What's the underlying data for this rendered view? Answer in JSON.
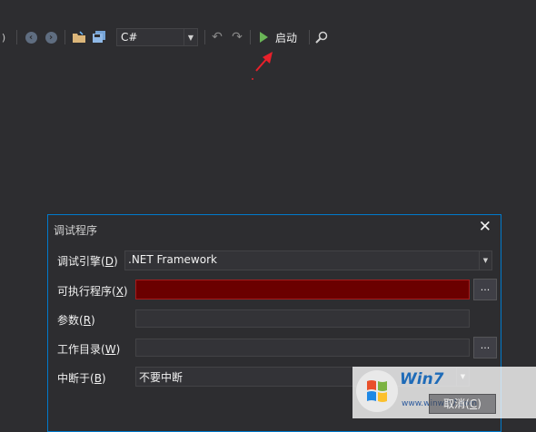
{
  "toolbar": {
    "language": "C#",
    "start_label": "启动"
  },
  "dialog": {
    "title": "调试程序",
    "close_icon": "close-icon",
    "fields": {
      "engine": {
        "label": "调试引擎(",
        "key": "D",
        "value": ".NET Framework"
      },
      "executable": {
        "label": "可执行程序(",
        "key": "X",
        "value": ""
      },
      "args": {
        "label": "参数(",
        "key": "R",
        "value": ""
      },
      "workdir": {
        "label": "工作目录(",
        "key": "W",
        "value": ""
      },
      "breakat": {
        "label": "中断于(",
        "key": "B",
        "value": "不要中断"
      }
    },
    "browse_label": "...",
    "cancel_label": "取消(",
    "cancel_key": "C"
  },
  "watermark": {
    "brand": "Win7",
    "url": "www.winwin7.com"
  },
  "colors": {
    "accent": "#007acc",
    "error_field": "#6b0000",
    "play": "#6ab557",
    "arrow": "#e8202a"
  }
}
